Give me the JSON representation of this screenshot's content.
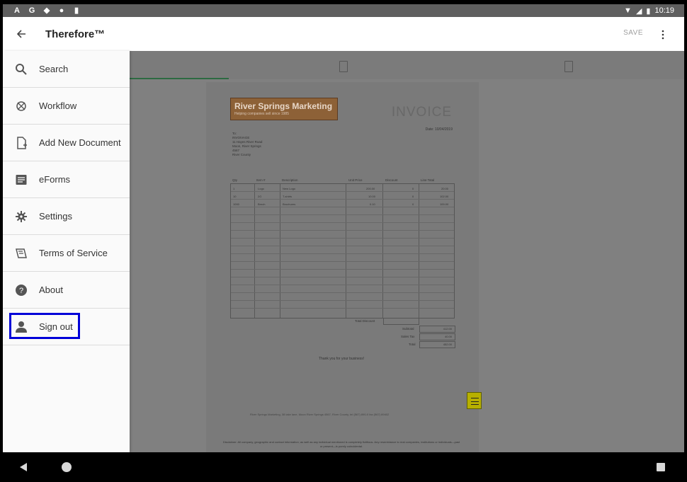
{
  "status": {
    "icons": [
      "a-icon",
      "g-icon",
      "play-protect-icon",
      "circle-icon",
      "sim-icon"
    ],
    "time": "10:19"
  },
  "appbar": {
    "title": "Therefore™",
    "save_label": "SAVE"
  },
  "drawer": {
    "items": [
      {
        "label": "Search",
        "icon": "search-icon"
      },
      {
        "label": "Workflow",
        "icon": "workflow-icon"
      },
      {
        "label": "Add New Document",
        "icon": "add-document-icon"
      },
      {
        "label": "eForms",
        "icon": "forms-icon"
      },
      {
        "label": "Settings",
        "icon": "gear-icon"
      },
      {
        "label": "Terms of Service",
        "icon": "terms-icon"
      },
      {
        "label": "About",
        "icon": "help-icon"
      },
      {
        "label": "Sign out",
        "icon": "person-icon"
      }
    ],
    "highlight_color": "#0000d8"
  },
  "document": {
    "company": "River Springs Marketing",
    "tagline": "Helping companies sell since 1985",
    "title": "INVOICE",
    "date": "Date: 10/04/2019",
    "address": [
      "To:",
      "INVOIVAGE",
      "11 Hayes River Road",
      "Moon, River Springs",
      "4567",
      "River County"
    ],
    "columns": [
      "Qty",
      "Item #",
      "Description",
      "Unit Price",
      "Discount",
      "Line Total"
    ],
    "rows": [
      [
        "1",
        "Logo",
        "New Logo",
        "200.00",
        "0",
        "20.00"
      ],
      [
        "10",
        "2G",
        "T-shirts",
        "10.00",
        "0",
        "102.00"
      ],
      [
        "1000",
        "Brnch",
        "Brochures",
        "0.10",
        "0",
        "100.00"
      ]
    ],
    "summary": {
      "total_discount_label": "Total Discount",
      "subtotal_label": "Subtotal",
      "sales_tax_label": "Sales Tax",
      "total_label": "Total",
      "subtotal": "412.00",
      "sales_tax": "40.00",
      "total": "452.00"
    },
    "thanks": "Thank you for your business!",
    "footer": "River Springs Marketing, 38 lake lane, Moon River Springs 4567, River County, tel (567) 890-0 fax (567) 89402",
    "disclaimer": "Disclaimer: All company, geographic and contact information, as well as any individual mentioned is completely fictitious. Any resemblance to real companies, institutions or individuals—past or present—is purely coincidental."
  }
}
